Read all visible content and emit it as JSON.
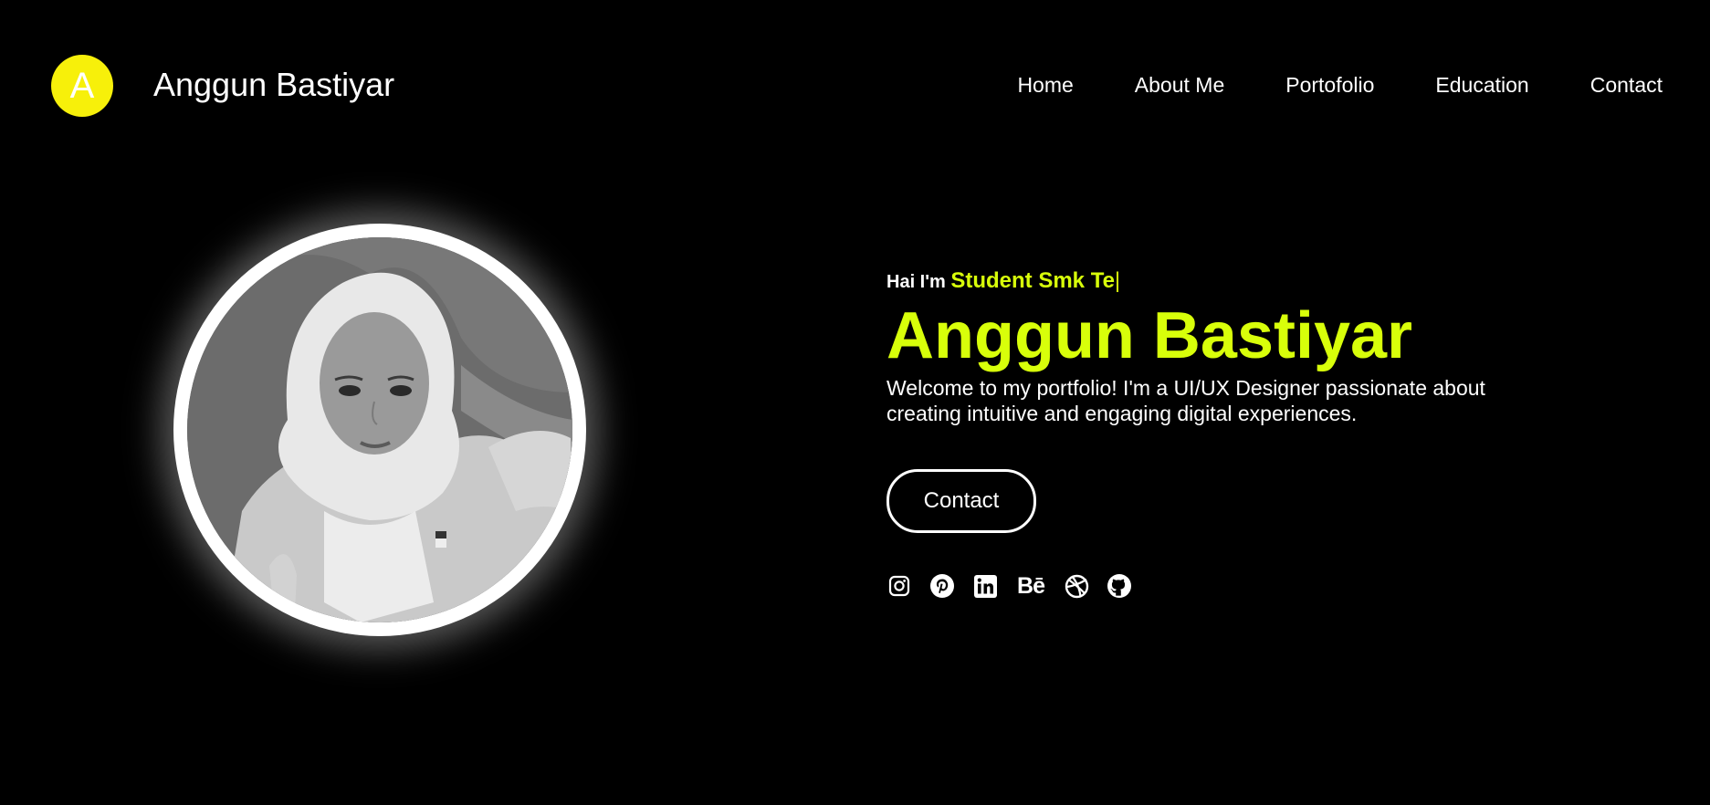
{
  "header": {
    "logo_letter": "A",
    "brand_name": "Anggun Bastiyar",
    "nav": [
      {
        "label": "Home"
      },
      {
        "label": "About Me"
      },
      {
        "label": "Portofolio"
      },
      {
        "label": "Education"
      },
      {
        "label": "Contact"
      }
    ]
  },
  "hero": {
    "greeting_lead": "Hai I'm",
    "typed_role": "Student Smk Te",
    "typing_caret": "|",
    "name": "Anggun Bastiyar",
    "description": "Welcome to my portfolio! I'm a UI/UX Designer passionate about creating intuitive and engaging digital experiences.",
    "contact_button": "Contact",
    "social_icons": [
      "instagram-icon",
      "pinterest-icon",
      "linkedin-icon",
      "behance-icon",
      "dribbble-icon",
      "github-icon"
    ],
    "behance_glyph": "Bē"
  },
  "colors": {
    "background": "#000000",
    "accent": "#d8ff0a",
    "logo_yellow": "#f7f00a",
    "text": "#ffffff"
  }
}
